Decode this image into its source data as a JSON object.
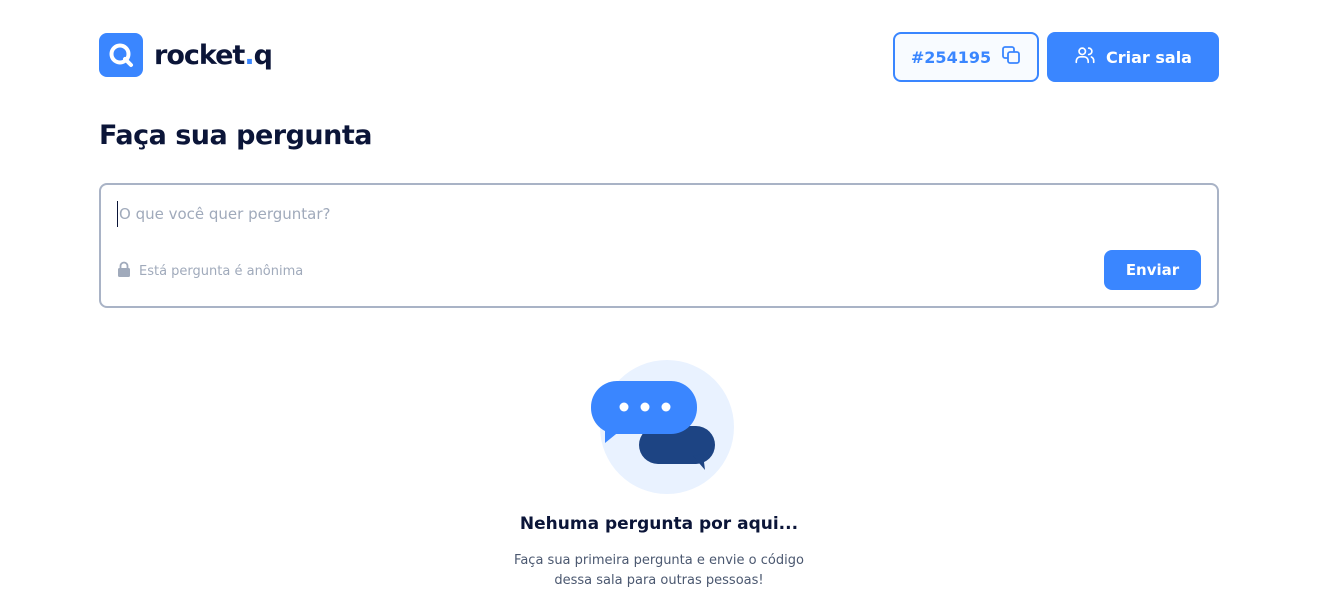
{
  "header": {
    "logo": {
      "text_main": "rocket",
      "text_dot": ".",
      "text_end": "q",
      "icon": "search-bubble-icon"
    },
    "room_code": {
      "label": "#254195",
      "icon": "copy-icon"
    },
    "create_room": {
      "label": "Criar sala",
      "icon": "users-icon"
    }
  },
  "main": {
    "title": "Faça sua pergunta",
    "question_form": {
      "placeholder": "O que você quer perguntar?",
      "value": "",
      "anon_label": "Está pergunta é anônima",
      "anon_icon": "lock-icon",
      "send_label": "Enviar"
    },
    "empty_state": {
      "illustration": "chat-bubbles-icon",
      "title": "Nehuma pergunta por aqui...",
      "description": "Faça sua primeira pergunta e envie o código dessa sala para outras pessoas!"
    }
  },
  "colors": {
    "primary": "#3a86ff",
    "dark": "#0b1538",
    "muted": "#a0aabb"
  }
}
